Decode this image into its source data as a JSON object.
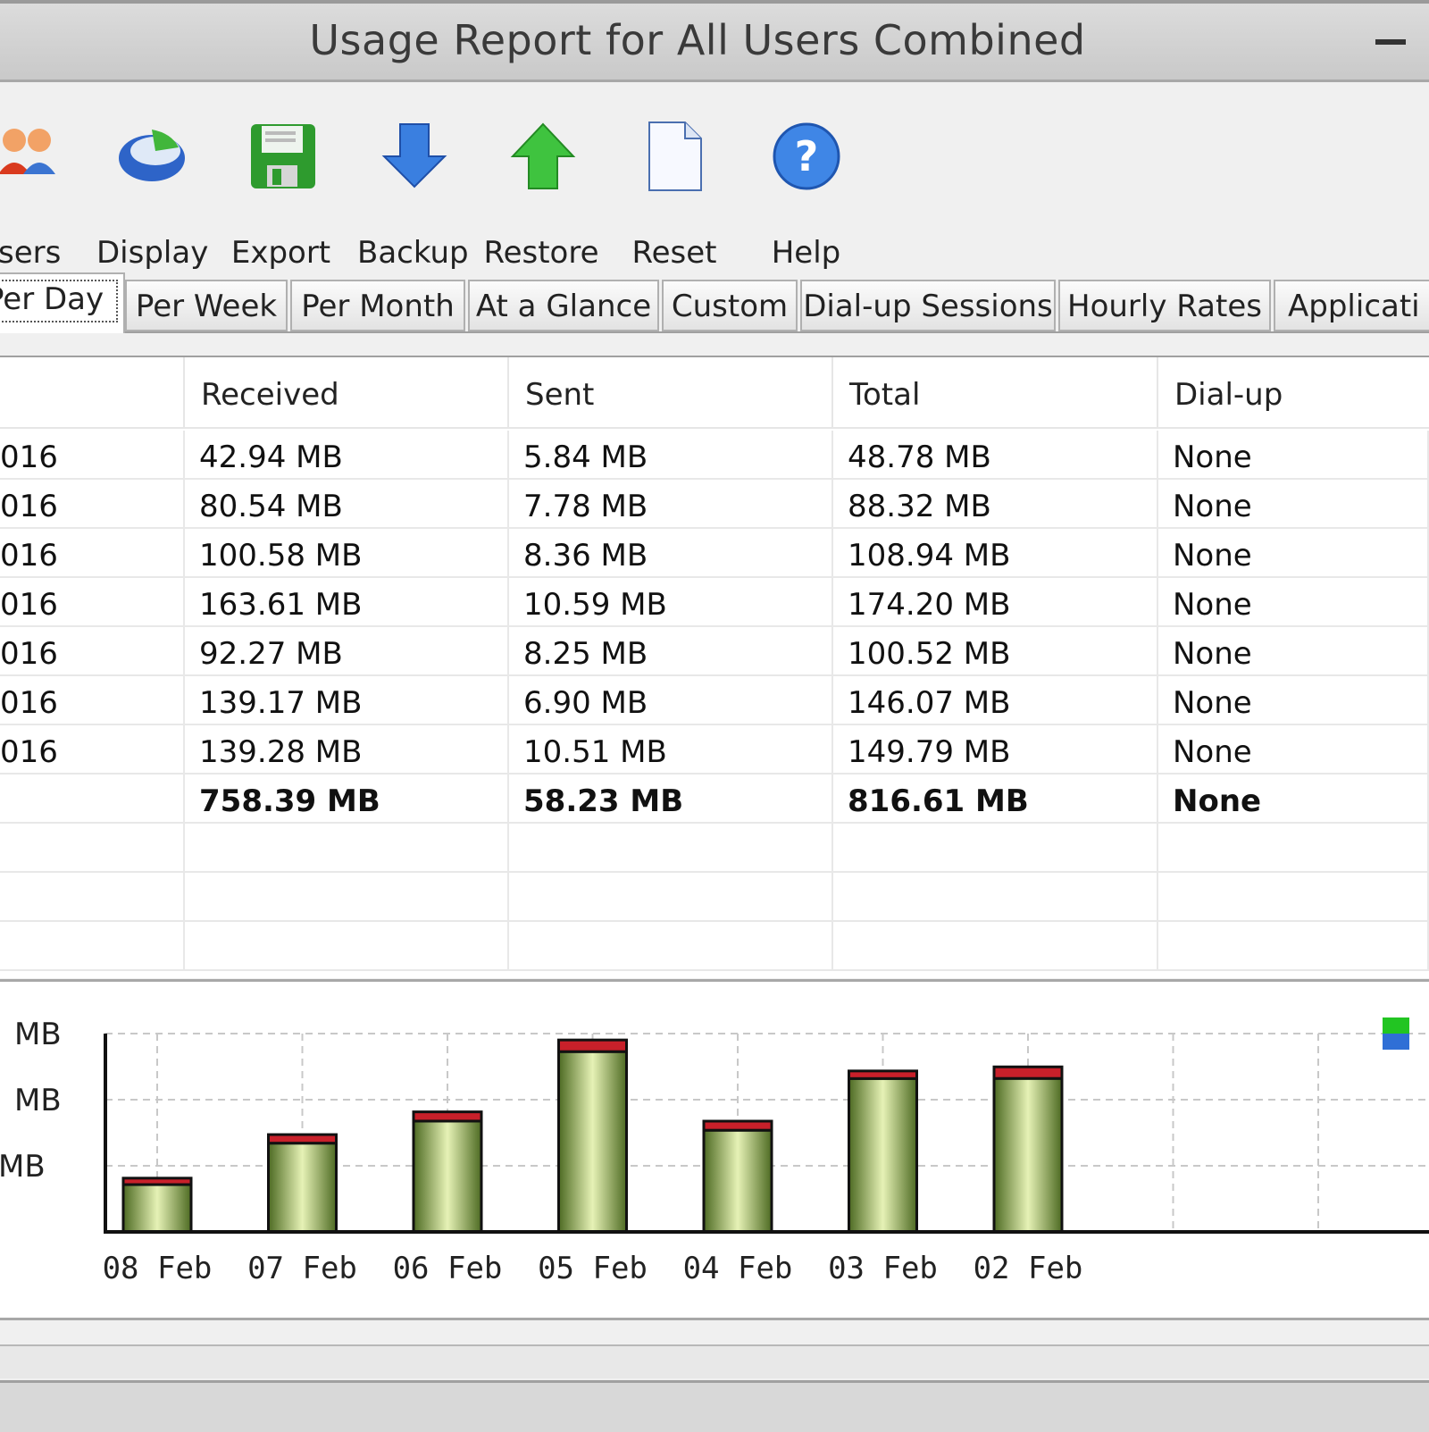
{
  "window": {
    "title": "Usage Report for All Users Combined"
  },
  "toolbar": {
    "items": [
      {
        "label": "Users",
        "visible_label": "sers",
        "icon": "users-icon"
      },
      {
        "label": "Display",
        "icon": "display-icon"
      },
      {
        "label": "Export",
        "icon": "floppy-icon"
      },
      {
        "label": "Backup",
        "icon": "arrow-down-icon"
      },
      {
        "label": "Restore",
        "icon": "arrow-up-icon"
      },
      {
        "label": "Reset",
        "icon": "blank-page-icon"
      },
      {
        "label": "Help",
        "icon": "help-icon"
      }
    ]
  },
  "tabs": [
    "Per Day",
    "Per Week",
    "Per Month",
    "At a Glance",
    "Custom",
    "Dial-up Sessions",
    "Hourly Rates",
    "Applicati"
  ],
  "active_tab": "Per Day",
  "table": {
    "columns": [
      "",
      "Received",
      "Sent",
      "Total",
      "Dial-up"
    ],
    "rows": [
      [
        "016",
        "42.94 MB",
        "5.84 MB",
        "48.78 MB",
        "None"
      ],
      [
        "016",
        "80.54 MB",
        "7.78 MB",
        "88.32 MB",
        "None"
      ],
      [
        "016",
        "100.58 MB",
        "8.36 MB",
        "108.94 MB",
        "None"
      ],
      [
        "016",
        "163.61 MB",
        "10.59 MB",
        "174.20 MB",
        "None"
      ],
      [
        "016",
        "92.27 MB",
        "8.25 MB",
        "100.52 MB",
        "None"
      ],
      [
        "016",
        "139.17 MB",
        "6.90 MB",
        "146.07 MB",
        "None"
      ],
      [
        "016",
        "139.28 MB",
        "10.51 MB",
        "149.79 MB",
        "None"
      ]
    ],
    "totals": [
      "",
      "758.39 MB",
      "58.23 MB",
      "816.61 MB",
      "None"
    ]
  },
  "chart_data": {
    "type": "bar",
    "categories": [
      "08 Feb",
      "07 Feb",
      "06 Feb",
      "05 Feb",
      "04 Feb",
      "03 Feb",
      "02 Feb"
    ],
    "series": [
      {
        "name": "Received",
        "values": [
          42.94,
          80.54,
          100.58,
          163.61,
          92.27,
          139.17,
          139.28
        ]
      },
      {
        "name": "Sent",
        "values": [
          5.84,
          7.78,
          8.36,
          10.59,
          8.25,
          6.9,
          10.51
        ]
      }
    ],
    "y_tick_labels": [
      "MB",
      "MB",
      "MB"
    ],
    "ylim": [
      0,
      180
    ],
    "grid": true,
    "legend": "top-right",
    "colors": {
      "received": "#8fa860",
      "sent": "#c8202a",
      "legend_green": "#22c522",
      "legend_blue": "#2f6fd6"
    }
  }
}
